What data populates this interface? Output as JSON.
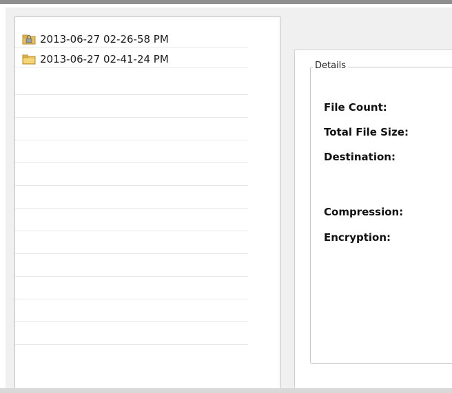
{
  "backup_list": {
    "items": [
      {
        "label": "2013-06-27 02-26-58 PM",
        "icon": "locked-folder-icon"
      },
      {
        "label": "2013-06-27 02-41-24 PM",
        "icon": "folder-icon"
      }
    ]
  },
  "details": {
    "group_title": "Details",
    "labels": {
      "file_count": "File Count:",
      "total_file_size": "Total File Size:",
      "destination": "Destination:",
      "compression": "Compression:",
      "encryption": "Encryption:"
    }
  },
  "colors": {
    "folder_yellow": "#e8c25a",
    "folder_dark": "#b8892a",
    "lock_gray": "#9aa0a6",
    "row_line": "#e8e8e8"
  }
}
